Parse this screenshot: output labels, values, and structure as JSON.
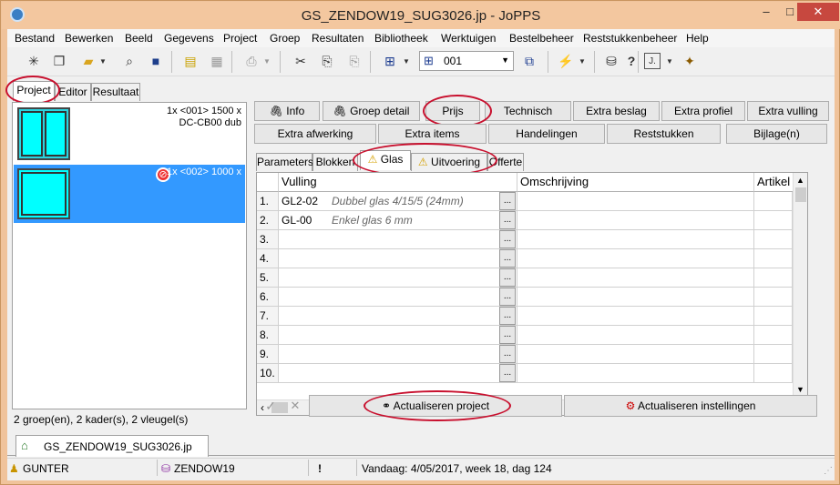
{
  "window": {
    "title": "GS_ZENDOW19_SUG3026.jp - JoPPS",
    "minimize": "–",
    "maximize": "□",
    "close": "✕"
  },
  "menu": [
    "Bestand",
    "Bewerken",
    "Beeld",
    "Gegevens",
    "Project",
    "Groep",
    "Resultaten",
    "Bibliotheek",
    "Werktuigen",
    "Bestelbeheer",
    "Reststukkenbeheer",
    "Help"
  ],
  "toolbar": {
    "combo_value": "001"
  },
  "left_tabs": [
    "Project",
    "Editor",
    "Resultaat"
  ],
  "groups": [
    {
      "line1": "1x <001> 1500 x",
      "line2": "DC-CB00 dub"
    },
    {
      "line1": "1x <002> 1000 x"
    }
  ],
  "left_status": "2 groep(en), 2 kader(s), 2 vleugel(s)",
  "buttons_row1": [
    "Info",
    "Groep detail",
    "Prijs",
    "Technisch",
    "Extra beslag",
    "Extra profiel",
    "Extra vulling"
  ],
  "buttons_row2": [
    "Extra afwerking",
    "Extra items",
    "Handelingen",
    "Reststukken",
    "Bijlage(n)"
  ],
  "detail_tabs": [
    "Parameters",
    "Blokken",
    "Glas",
    "Uitvoering",
    "Offerte"
  ],
  "grid": {
    "columns": [
      "Vulling",
      "Omschrijving",
      "Artikel nr"
    ],
    "rows": [
      {
        "num": "1.",
        "code": "GL2-02",
        "desc": "Dubbel glas 4/15/5 (24mm)"
      },
      {
        "num": "2.",
        "code": "GL-00",
        "desc": "Enkel glas 6 mm"
      },
      {
        "num": "3.",
        "code": "",
        "desc": ""
      },
      {
        "num": "4.",
        "code": "",
        "desc": ""
      },
      {
        "num": "5.",
        "code": "",
        "desc": ""
      },
      {
        "num": "6.",
        "code": "",
        "desc": ""
      },
      {
        "num": "7.",
        "code": "",
        "desc": ""
      },
      {
        "num": "8.",
        "code": "",
        "desc": ""
      },
      {
        "num": "9.",
        "code": "",
        "desc": ""
      },
      {
        "num": "10.",
        "code": "",
        "desc": ""
      }
    ],
    "dots": "..."
  },
  "actions": {
    "refresh_project": "Actualiseren project",
    "refresh_settings": "Actualiseren instellingen"
  },
  "doc_tab": "GS_ZENDOW19_SUG3026.jp",
  "statusbar": {
    "user": "GUNTER",
    "db": "ZENDOW19",
    "alert": "!",
    "date": "Vandaag: 4/05/2017, week 18, dag 124"
  }
}
